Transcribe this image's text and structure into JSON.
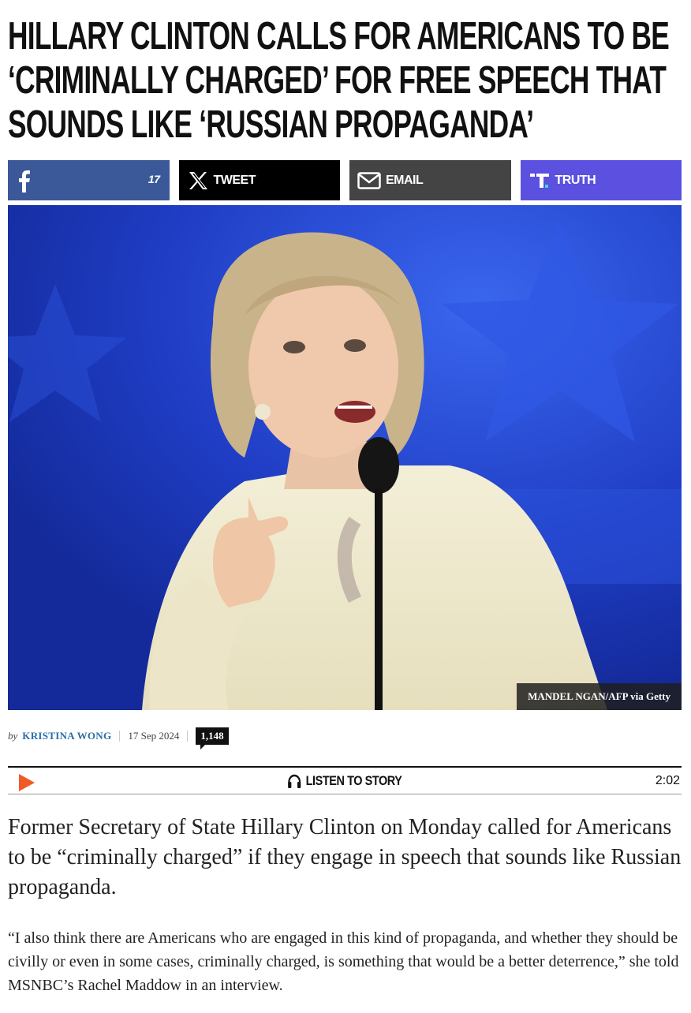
{
  "article": {
    "headline": "HILLARY CLINTON CALLS FOR AMERICANS TO BE ‘CRIMINALLY CHARGED’ FOR FREE SPEECH THAT SOUNDS LIKE ‘RUSSIAN PROPAGANDA’",
    "share": {
      "facebook_count": "17",
      "tweet_label": "TWEET",
      "email_label": "EMAIL",
      "truth_label": "TRUTH"
    },
    "image_credit": "MANDEL NGAN/AFP via Getty",
    "byline": {
      "prefix": "by",
      "author": "KRISTINA WONG",
      "date": "17 Sep 2024",
      "comment_count": "1,148"
    },
    "audio": {
      "label": "LISTEN TO STORY",
      "duration": "2:02"
    },
    "lede": "Former Secretary of State Hillary Clinton on Monday called for Americans to be “criminally charged” if they engage in speech that sounds like Russian propaganda.",
    "paragraph_1": "“I also think there are Americans who are engaged in this kind of propaganda, and whether they should be civilly or even in some cases, criminally charged, is something that would be a better deterrence,” she told MSNBC’s Rachel Maddow in an interview."
  },
  "colors": {
    "facebook": "#3b5998",
    "tweet": "#000000",
    "email": "#444444",
    "truth": "#5b50e0",
    "play": "#f05a28",
    "author_link": "#2a6ea6"
  },
  "icons": {
    "facebook": "facebook-icon",
    "x": "x-icon",
    "email": "envelope-icon",
    "truth": "truth-social-icon",
    "headphones": "headphones-icon",
    "play": "play-icon"
  }
}
